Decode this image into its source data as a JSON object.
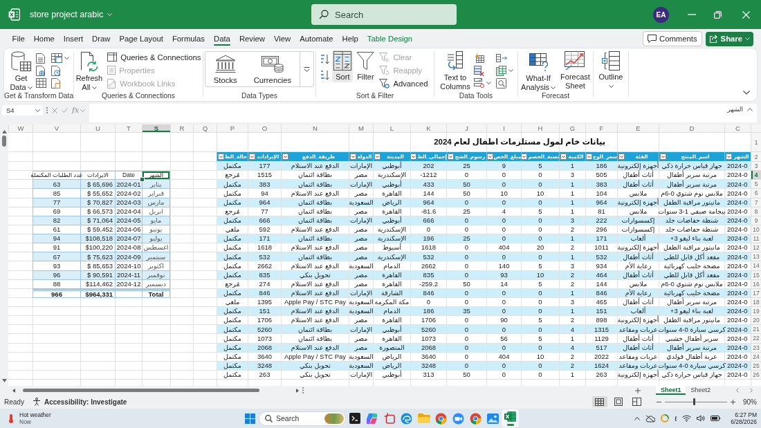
{
  "title_bar": {
    "workbook": "store project arabic",
    "search": {
      "placeholder": "Search"
    },
    "avatar": "EA"
  },
  "menu_tabs": [
    {
      "label": "Table Design",
      "kind": "contextual",
      "selected": false
    },
    {
      "label": "Help",
      "kind": "standard",
      "selected": false
    },
    {
      "label": "Automate",
      "kind": "standard",
      "selected": false
    },
    {
      "label": "View",
      "kind": "standard",
      "selected": false
    },
    {
      "label": "Review",
      "kind": "standard",
      "selected": false
    },
    {
      "label": "Data",
      "kind": "standard",
      "selected": true
    },
    {
      "label": "Formulas",
      "kind": "standard",
      "selected": false
    },
    {
      "label": "Page Layout",
      "kind": "standard",
      "selected": false
    },
    {
      "label": "Draw",
      "kind": "standard",
      "selected": false
    },
    {
      "label": "Insert",
      "kind": "standard",
      "selected": false
    },
    {
      "label": "Home",
      "kind": "standard",
      "selected": false
    },
    {
      "label": "File",
      "kind": "standard",
      "selected": false
    }
  ],
  "header_buttons": {
    "comments": "Comments",
    "share": "Share"
  },
  "ribbon": {
    "groups": [
      {
        "commands": [
          {
            "label": "Outline",
            "kind": "large",
            "dropdown": true,
            "disabled": false,
            "hovered": false
          }
        ]
      },
      {
        "label": "Forecast",
        "commands": [
          {
            "label": "Forecast Sheet",
            "kind": "large",
            "disabled": false,
            "hovered": false
          },
          {
            "label": "What-If Analysis",
            "kind": "large",
            "dropdown": true,
            "disabled": false,
            "hovered": false
          }
        ]
      },
      {
        "label": "Data Tools",
        "commands": [
          {
            "label": "Text to Columns",
            "kind": "large",
            "disabled": false,
            "hovered": false
          }
        ]
      },
      {
        "label": "Sort & Filter",
        "commands": [
          {
            "label": "Clear",
            "kind": "small",
            "disabled": true,
            "hovered": false
          },
          {
            "label": "Reapply",
            "kind": "small",
            "disabled": true,
            "hovered": false
          },
          {
            "label": "Advanced",
            "kind": "small",
            "disabled": false,
            "hovered": false
          },
          {
            "label": "Filter",
            "kind": "large",
            "disabled": false,
            "hovered": false
          },
          {
            "label": "Sort",
            "kind": "large",
            "disabled": false,
            "hovered": true
          }
        ]
      },
      {
        "label": "Data Types",
        "commands": [
          {
            "label": "Currencies",
            "kind": "gallery",
            "disabled": false,
            "hovered": false
          },
          {
            "label": "Stocks",
            "kind": "gallery",
            "disabled": false,
            "hovered": false
          }
        ]
      },
      {
        "label": "Queries & Connections",
        "commands": [
          {
            "label": "Queries & Connections",
            "kind": "small",
            "disabled": false,
            "hovered": false
          },
          {
            "label": "Properties",
            "kind": "small",
            "disabled": true,
            "hovered": false
          },
          {
            "label": "Workbook Links",
            "kind": "small",
            "disabled": true,
            "hovered": false
          },
          {
            "label": "Refresh All",
            "kind": "large",
            "dropdown": true,
            "disabled": false,
            "hovered": false
          }
        ]
      },
      {
        "label": "Get & Transform Data",
        "commands": [
          {
            "label": "Get Data",
            "kind": "large",
            "dropdown": true,
            "disabled": false,
            "hovered": false
          }
        ]
      }
    ]
  },
  "formula_bar": {
    "name_box": "S4",
    "insert_function": "fx",
    "content": "الشهر"
  },
  "sheet": {
    "columns": [
      {
        "label": "C",
        "selected": false
      },
      {
        "label": "D",
        "selected": false
      },
      {
        "label": "E",
        "selected": false
      },
      {
        "label": "F",
        "selected": false
      },
      {
        "label": "G",
        "selected": false
      },
      {
        "label": "H",
        "selected": false
      },
      {
        "label": "I",
        "selected": false
      },
      {
        "label": "J",
        "selected": false
      },
      {
        "label": "K",
        "selected": false
      },
      {
        "label": "L",
        "selected": false
      },
      {
        "label": "M",
        "selected": false
      },
      {
        "label": "N",
        "selected": false
      },
      {
        "label": "O",
        "selected": false
      },
      {
        "label": "P",
        "selected": false
      },
      {
        "label": "Q",
        "selected": false
      },
      {
        "label": "R",
        "selected": false
      },
      {
        "label": "S",
        "selected": true
      },
      {
        "label": "T",
        "selected": false
      },
      {
        "label": "U",
        "selected": false
      },
      {
        "label": "V",
        "selected": false
      },
      {
        "label": "W",
        "selected": false
      }
    ],
    "rows": [
      {
        "label": "1",
        "selected": false
      },
      {
        "label": "2",
        "selected": false
      },
      {
        "label": "3",
        "selected": false
      },
      {
        "label": "4",
        "selected": true
      },
      {
        "label": "5",
        "selected": false
      },
      {
        "label": "6",
        "selected": false
      },
      {
        "label": "7",
        "selected": false
      },
      {
        "label": "8",
        "selected": false
      },
      {
        "label": "9",
        "selected": false
      },
      {
        "label": "10",
        "selected": false
      },
      {
        "label": "11",
        "selected": false
      },
      {
        "label": "12",
        "selected": false
      },
      {
        "label": "13",
        "selected": false
      },
      {
        "label": "14",
        "selected": false
      },
      {
        "label": "15",
        "selected": false
      },
      {
        "label": "16",
        "selected": false
      },
      {
        "label": "17",
        "selected": false
      },
      {
        "label": "18",
        "selected": false
      },
      {
        "label": "19",
        "selected": false
      },
      {
        "label": "20",
        "selected": false
      },
      {
        "label": "21",
        "selected": false
      },
      {
        "label": "22",
        "selected": false
      },
      {
        "label": "23",
        "selected": false
      },
      {
        "label": "24",
        "selected": false
      },
      {
        "label": "25",
        "selected": false
      },
      {
        "label": "26",
        "selected": false
      }
    ],
    "data_table": {
      "title": "بيانات خام لمول مستلزمات اطفال لعام 2024",
      "columns": [
        "الشهر",
        "اسم_المنتج",
        "الفئة",
        "سعر_الوح",
        "الكمية",
        "نسبة_الخصم",
        "مبلغ_الخص",
        "رسوم_الشح",
        "إجمالي_الط",
        "المدينة",
        "الدولة",
        "طريقة_الدفع",
        "الإيرادات",
        "حالة_الط"
      ],
      "rows": [
        [
          "2024-0",
          "جهاز قياس حرارة ذكي",
          "أجهزة إلكترونية",
          "186",
          "1",
          "5",
          "9",
          "25",
          "202",
          "أبوظبي",
          "الإمارات",
          "الدفع عند الاستلام",
          "177",
          "مكتمل"
        ],
        [
          "2024-0",
          "مرتبة سرير أطفال",
          "أثاث أطفال",
          "505",
          "3",
          "0",
          "0",
          "0",
          "-1212",
          "الإسكندرية",
          "مصر",
          "بطاقة ائتمان",
          "1515",
          "مُرجع"
        ],
        [
          "2024-0",
          "مرتبة سرير أطفال",
          "أثاث أطفال",
          "383",
          "1",
          "0",
          "0",
          "50",
          "433",
          "أبوظبي",
          "الإمارات",
          "بطاقة ائتمان",
          "383",
          "مكتمل"
        ],
        [
          "2024-0",
          "ملابس نوم شتوي 0-6م",
          "ملابس",
          "104",
          "1",
          "10",
          "10",
          "50",
          "144",
          "القاهرة",
          "مصر",
          "الدفع عند الاستلام",
          "94",
          "مكتمل"
        ],
        [
          "2024-0",
          "مانيتور مراقبة الطفل",
          "أجهزة إلكترونية",
          "964",
          "1",
          "0",
          "0",
          "0",
          "964",
          "الرياض",
          "السعودية",
          "بطاقة ائتمان",
          "964",
          "مكتمل"
        ],
        [
          "2024-0",
          "بيجامة صيفي 1-3 سنوات",
          "ملابس",
          "81",
          "1",
          "5",
          "4",
          "25",
          "-81.6",
          "القاهرة",
          "مصر",
          "بطاقة ائتمان",
          "77",
          "مُرجع"
        ],
        [
          "2024-0",
          "شنطة حفاضات جلد",
          "إكسسوارات",
          "222",
          "3",
          "0",
          "0",
          "0",
          "666",
          "أبوظبي",
          "الإمارات",
          "بطاقة ائتمان",
          "666",
          "مكتمل"
        ],
        [
          "2024-0",
          "شنطة حفاضات جلد",
          "إكسسوارات",
          "296",
          "2",
          "0",
          "0",
          "0",
          "0",
          "الإسكندرية",
          "مصر",
          "الدفع عند الاستلام",
          "592",
          "ملغي"
        ],
        [
          "2024-0",
          "لعبة بناء ليغو 3+",
          "ألعاب",
          "171",
          "1",
          "0",
          "0",
          "25",
          "196",
          "الإسكندرية",
          "مصر",
          "بطاقة ائتمان",
          "171",
          "مكتمل"
        ],
        [
          "2024-0",
          "مانيتور مراقبة الطفل",
          "أجهزة إلكترونية",
          "1011",
          "2",
          "20",
          "404",
          "0",
          "1618",
          "أسيوط",
          "مصر",
          "الدفع عند الاستلام",
          "1618",
          "مكتمل"
        ],
        [
          "2024-0",
          "مقعد أكل قابل للطي",
          "أثاث أطفال",
          "532",
          "1",
          "0",
          "0",
          "0",
          "532",
          "الإسكندرية",
          "مصر",
          "بطاقة ائتمان",
          "532",
          "مكتمل"
        ],
        [
          "2024-0",
          "مضخة حليب كهربائية",
          "رعاية الأم",
          "934",
          "3",
          "5",
          "140",
          "0",
          "2662",
          "الدمام",
          "السعودية",
          "الدفع عند الاستلام",
          "2662",
          "مكتمل"
        ],
        [
          "2024-0",
          "مقعد أكل قابل للطي",
          "أثاث أطفال",
          "464",
          "2",
          "10",
          "93",
          "0",
          "835",
          "القاهرة",
          "مصر",
          "تحويل بنكي",
          "835",
          "مكتمل"
        ],
        [
          "2024-0",
          "ملابس نوم شتوي 0-6م",
          "ملابس",
          "144",
          "2",
          "5",
          "14",
          "50",
          "-259.2",
          "القاهرة",
          "مصر",
          "الدفع عند الاستلام",
          "274",
          "مُرجع"
        ],
        [
          "2024-0",
          "مضخة حليب كهربائية",
          "رعاية الأم",
          "846",
          "1",
          "0",
          "0",
          "0",
          "846",
          "الشارقة",
          "الإمارات",
          "الدفع عند الاستلام",
          "846",
          "مكتمل"
        ],
        [
          "2024-0",
          "مرتبة سرير أطفال",
          "أثاث أطفال",
          "465",
          "3",
          "0",
          "0",
          "0",
          "0",
          "مكة المكرمة",
          "السعودية",
          "Apple Pay / STC Pay",
          "1395",
          "ملغي"
        ],
        [
          "2024-0",
          "لعبة بناء ليغو 3+",
          "ألعاب",
          "151",
          "1",
          "0",
          "0",
          "35",
          "186",
          "الدمام",
          "السعودية",
          "الدفع عند الاستلام",
          "151",
          "مكتمل"
        ],
        [
          "2024-0",
          "مانيتور مراقبة الطفل",
          "أجهزة إلكترونية",
          "898",
          "2",
          "5",
          "90",
          "0",
          "1706",
          "القاهرة",
          "مصر",
          "الدفع عند الاستلام",
          "1706",
          "مكتمل"
        ],
        [
          "2024-0",
          "كرسي سيارة 0-4 سنوات",
          "عربات ومقاعد",
          "1315",
          "4",
          "0",
          "0",
          "0",
          "5260",
          "أبوظبي",
          "الإمارات",
          "بطاقة ائتمان",
          "5260",
          "مكتمل"
        ],
        [
          "2024-0",
          "سرير أطفال خشبي",
          "أثاث أطفال",
          "1129",
          "1",
          "5",
          "56",
          "0",
          "1073",
          "القاهرة",
          "مصر",
          "بطاقة ائتمان",
          "1073",
          "مكتمل"
        ],
        [
          "2024-0",
          "مرتبة سرير أطفال",
          "أثاث أطفال",
          "517",
          "4",
          "0",
          "0",
          "0",
          "2068",
          "المنصورة",
          "مصر",
          "الدفع عند الاستلام",
          "2068",
          "مكتمل"
        ],
        [
          "2024-0",
          "عربة أطفال فولدي",
          "عربات ومقاعد",
          "2022",
          "2",
          "10",
          "404",
          "0",
          "3640",
          "الرياض",
          "السعودية",
          "Apple Pay / STC Pay",
          "3640",
          "مكتمل"
        ],
        [
          "2024-0",
          "كرسي سيارة 0-4 سنوات",
          "عربات ومقاعد",
          "1624",
          "2",
          "0",
          "0",
          "0",
          "3248",
          "الرياض",
          "السعودية",
          "تحويل بنكي",
          "3248",
          "مكتمل"
        ],
        [
          "2024-0",
          "جهاز قياس حرارة ذكي",
          "أجهزة إلكترونية",
          "263",
          "1",
          "0",
          "0",
          "50",
          "313",
          "أبوظبي",
          "الإمارات",
          "تحويل بنكي",
          "263",
          "مكتمل"
        ]
      ]
    },
    "summary_table": {
      "columns": [
        "الشهر",
        "Date",
        "الايرادات",
        "عدد الطلبات المكتملة"
      ],
      "rows": [
        [
          "يناير",
          "2024-01",
          "$ 65,696",
          "63"
        ],
        [
          "فبراير",
          "2024-02",
          "$ 55,652",
          "85"
        ],
        [
          "مارس",
          "2024-03",
          "$ 70,827",
          "77"
        ],
        [
          "ابريل",
          "2024-04",
          "$ 66,573",
          "69"
        ],
        [
          "مايو",
          "2024-05",
          "$ 71,064",
          "82"
        ],
        [
          "يونيو",
          "2024-06",
          "$ 59,452",
          "61"
        ],
        [
          "يوليو",
          "2024-07",
          "$108,518",
          "94"
        ],
        [
          "اغسطس",
          "2024-08",
          "$100,220",
          "91"
        ],
        [
          "سبتمبر",
          "2024-09",
          "$ 75,623",
          "67"
        ],
        [
          "اكتوبر",
          "2024-10",
          "$ 85,653",
          "93"
        ],
        [
          "نوفمبر",
          "2024-11",
          "$ 90,591",
          "96"
        ],
        [
          "ديسمبر",
          "2024-12",
          "$114,462",
          "88"
        ]
      ],
      "total": {
        "label": "Total",
        "revenue": "$964,331",
        "count": "966"
      }
    }
  },
  "sheet_tabs": [
    {
      "label": "Sheet2",
      "selected": false
    },
    {
      "label": "Sheet1",
      "selected": true
    }
  ],
  "status_bar": {
    "status": "Ready",
    "accessibility": "Accessibility: Investigate",
    "views": [
      {
        "kind": "normal",
        "selected": true
      },
      {
        "kind": "page_layout",
        "selected": false
      },
      {
        "kind": "page_break",
        "selected": false
      }
    ],
    "zoom": {
      "level": 0.47,
      "reading": "90%"
    }
  },
  "taskbar": {
    "weather": {
      "title": "Hot weather",
      "subtitle": "Now"
    },
    "search": {
      "placeholder": "Search"
    },
    "apps": [
      {
        "kind": "terminal",
        "active": false
      },
      {
        "kind": "assistant",
        "active": false
      },
      {
        "kind": "snipping",
        "active": false
      },
      {
        "kind": "wave_browser",
        "active": false
      },
      {
        "kind": "files",
        "active": false
      },
      {
        "kind": "browser",
        "active": false
      },
      {
        "kind": "video",
        "active": false
      },
      {
        "kind": "browser",
        "active": false
      },
      {
        "kind": "photos",
        "active": false
      },
      {
        "kind": "spreadsheet",
        "active": true
      }
    ],
    "input_indicator": "ℓ",
    "clock": {
      "time": "6:27 PM",
      "date": "6/28/2026"
    }
  }
}
